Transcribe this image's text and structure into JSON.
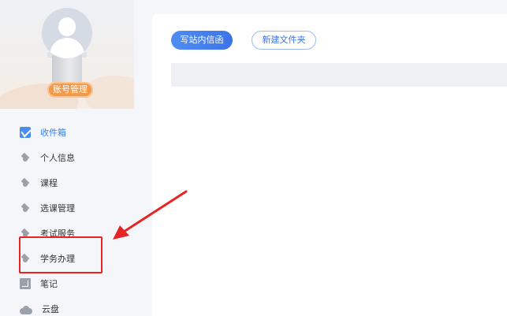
{
  "profile": {
    "account_button": "账号管理"
  },
  "sidebar": {
    "items": [
      {
        "label": "收件箱",
        "icon": "mail-icon",
        "active": true
      },
      {
        "label": "个人信息",
        "icon": "graduation-cap-icon",
        "active": false
      },
      {
        "label": "课程",
        "icon": "graduation-cap-icon",
        "active": false
      },
      {
        "label": "选课管理",
        "icon": "graduation-cap-icon",
        "active": false
      },
      {
        "label": "考试服务",
        "icon": "graduation-cap-icon",
        "active": false
      },
      {
        "label": "学务办理",
        "icon": "graduation-cap-icon",
        "active": false
      },
      {
        "label": "笔记",
        "icon": "note-icon",
        "active": false
      },
      {
        "label": "云盘",
        "icon": "cloud-icon",
        "active": false
      }
    ]
  },
  "main": {
    "compose_button": "写站内信函",
    "new_folder_button": "新建文件夹"
  },
  "colors": {
    "accent": "#3b7df0",
    "badge": "#f39a48",
    "annotation": "#e62424"
  }
}
